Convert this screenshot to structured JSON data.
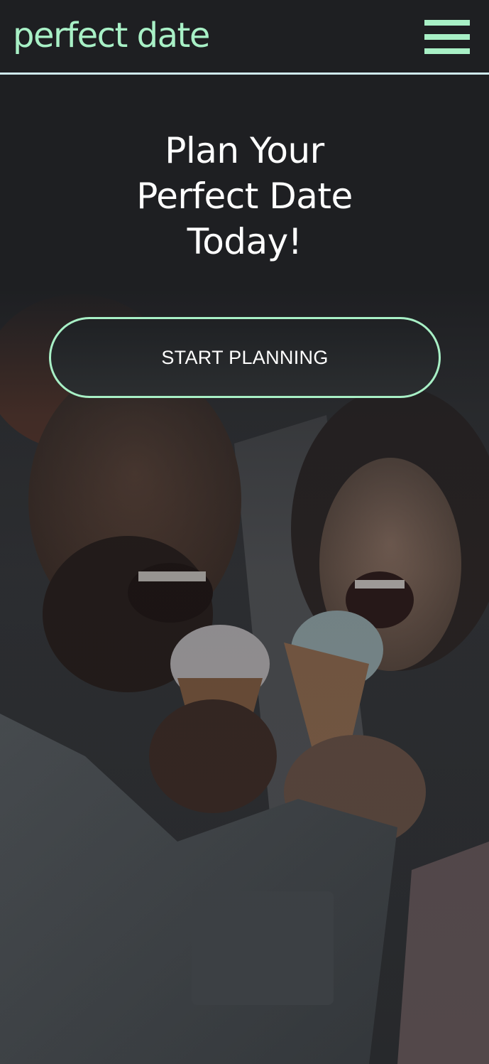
{
  "header": {
    "brand": "perfect date",
    "menu_icon": "hamburger-menu-icon"
  },
  "hero": {
    "headline_lines": [
      "Plan Your",
      "Perfect Date",
      "Today!"
    ],
    "cta_label": "START PLANNING",
    "image_description_icon": "couple-eating-ice-cream-photo"
  },
  "colors": {
    "accent": "#a8f0c6",
    "background": "#1e1f22",
    "divider": "#cfe9ee",
    "text": "#ffffff"
  }
}
